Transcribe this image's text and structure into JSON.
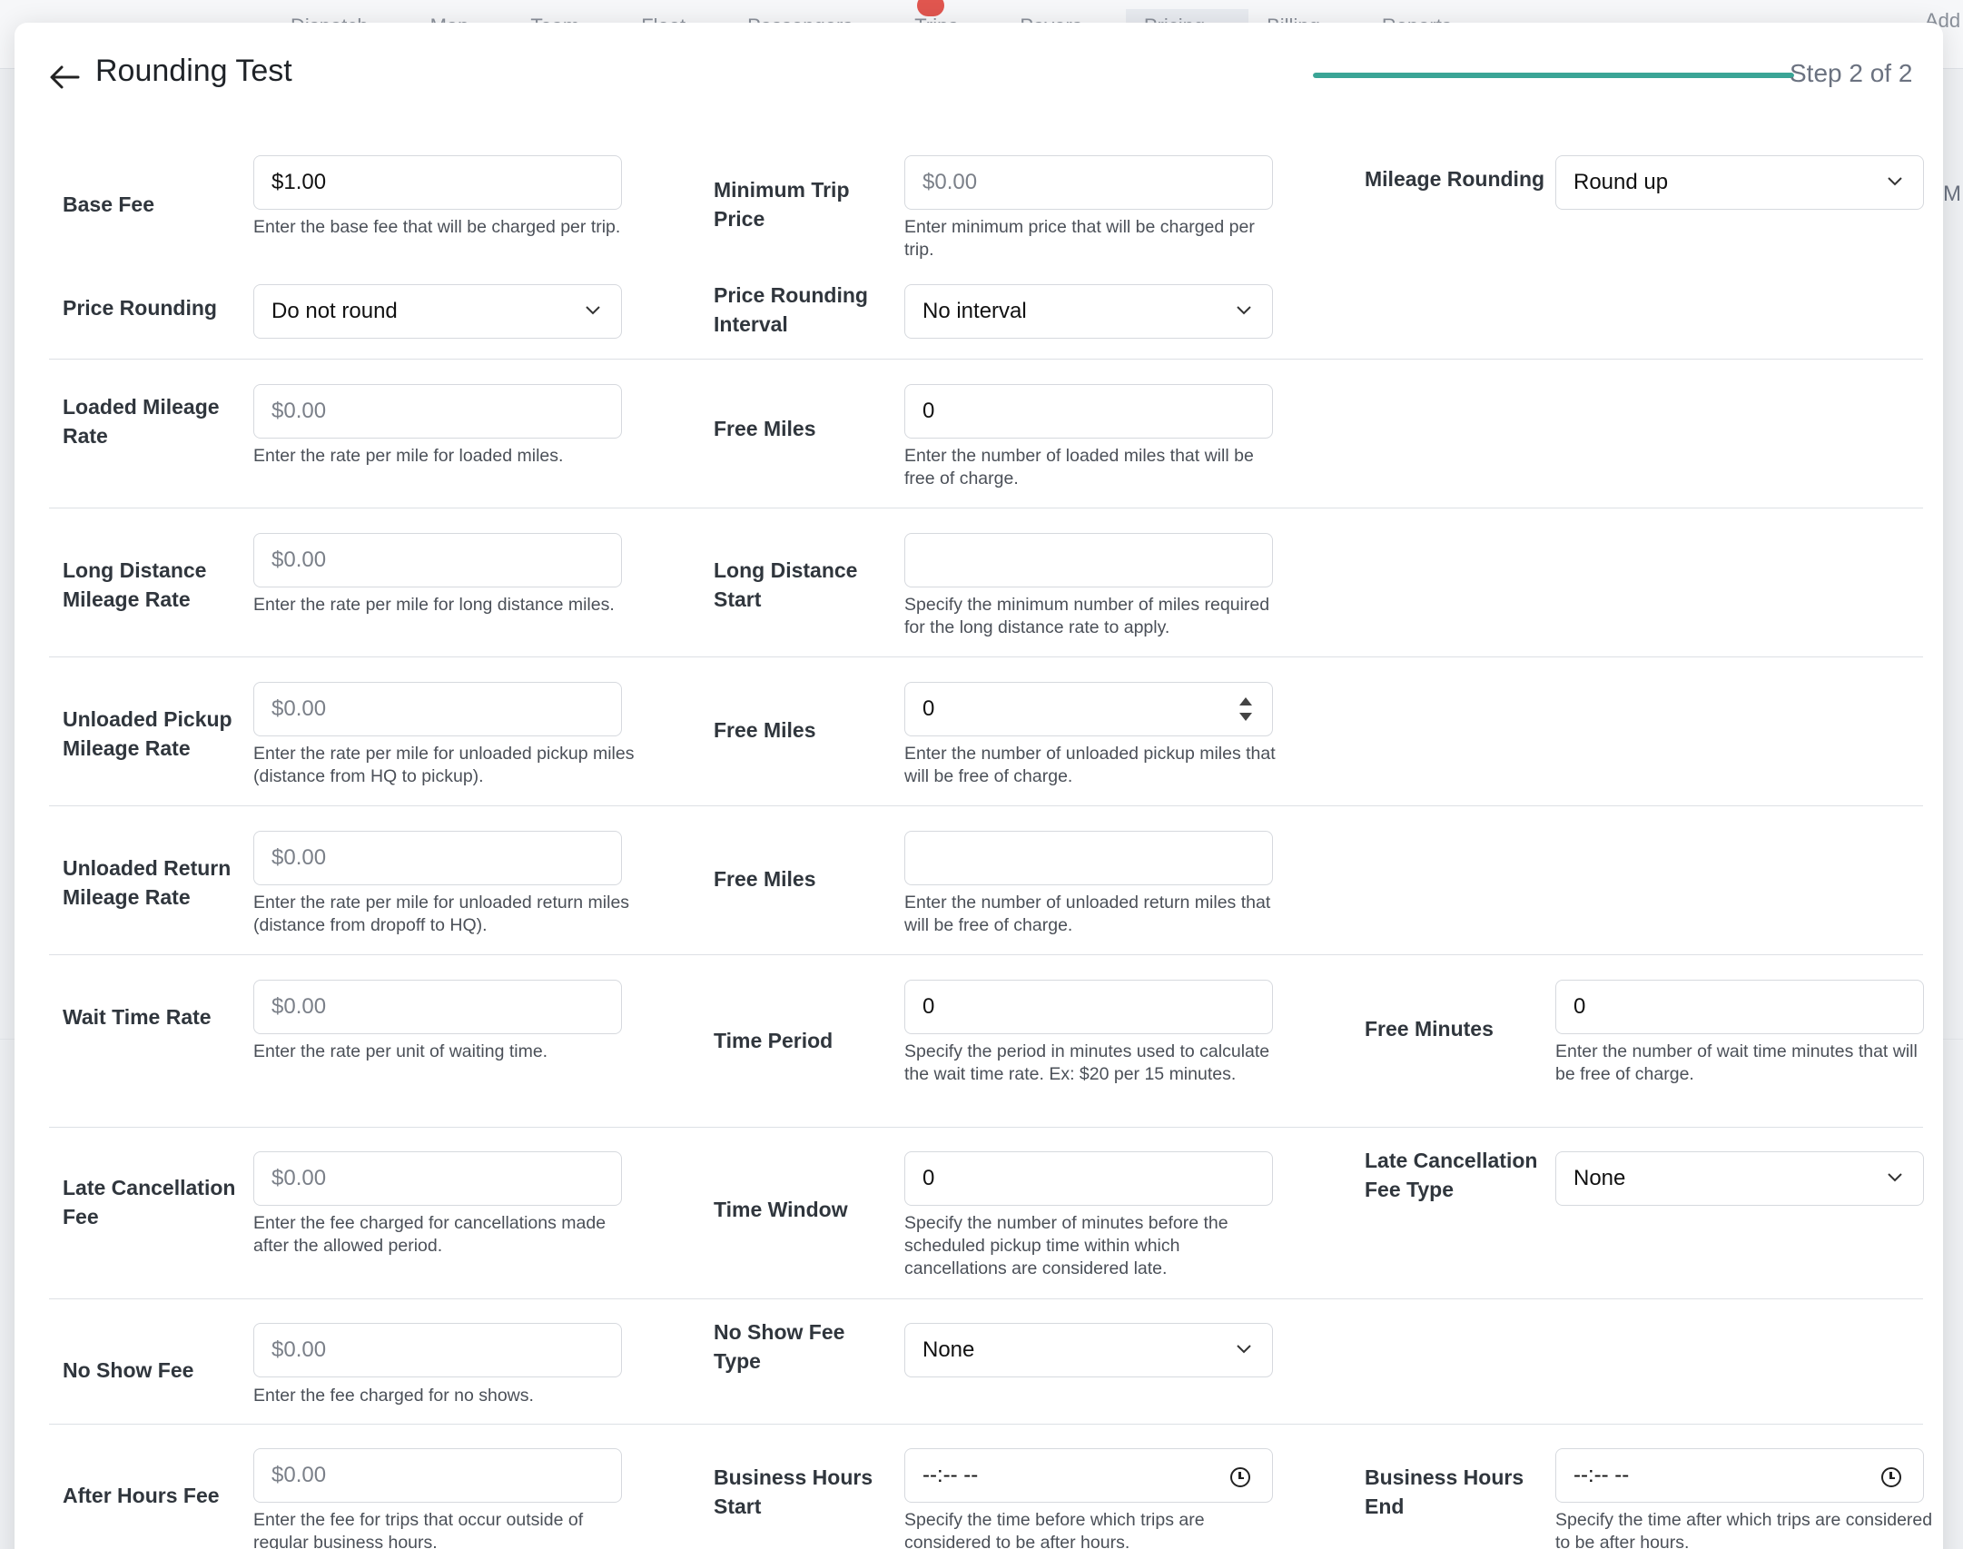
{
  "background": {
    "tabs": [
      "Dispatch",
      "Map",
      "Team",
      "Fleet",
      "Passengers",
      "Trips",
      "Payers",
      "Pricing",
      "Billing",
      "Reports"
    ],
    "right_text": "Add",
    "side_letter": "M"
  },
  "header": {
    "title": "Rounding Test",
    "step_label": "Step 2 of 2",
    "progress_fraction": 1.0
  },
  "colors": {
    "accent": "#3aa596"
  },
  "fields": {
    "base_fee": {
      "label": "Base Fee",
      "value": "$1.00",
      "help": "Enter the base fee that will be charged per trip."
    },
    "minimum_trip_price": {
      "label": "Minimum Trip Price",
      "placeholder": "$0.00",
      "help": "Enter minimum price that will be charged per trip."
    },
    "mileage_rounding": {
      "label": "Mileage Rounding",
      "value": "Round up"
    },
    "price_rounding": {
      "label": "Price Rounding",
      "value": "Do not round"
    },
    "price_rounding_interval": {
      "label": "Price Rounding Interval",
      "value": "No interval"
    },
    "loaded_mileage_rate": {
      "label": "Loaded Mileage Rate",
      "placeholder": "$0.00",
      "help": "Enter the rate per mile for loaded miles."
    },
    "loaded_free_miles": {
      "label": "Free Miles",
      "value": "0",
      "help": "Enter the number of loaded miles that will be free of charge."
    },
    "long_distance_rate": {
      "label": "Long Distance Mileage Rate",
      "placeholder": "$0.00",
      "help": "Enter the rate per mile for long distance miles."
    },
    "long_distance_start": {
      "label": "Long Distance Start",
      "value": "",
      "help": "Specify the minimum number of miles required for the long distance rate to apply."
    },
    "unloaded_pickup_rate": {
      "label": "Unloaded Pickup Mileage Rate",
      "placeholder": "$0.00",
      "help": "Enter the rate per mile for unloaded pickup miles (distance from HQ to pickup)."
    },
    "unloaded_pickup_free_miles": {
      "label": "Free Miles",
      "value": "0",
      "help": "Enter the number of unloaded pickup miles that will be free of charge."
    },
    "unloaded_return_rate": {
      "label": "Unloaded Return Mileage Rate",
      "placeholder": "$0.00",
      "help": "Enter the rate per mile for unloaded return miles (distance from dropoff to HQ)."
    },
    "unloaded_return_free_miles": {
      "label": "Free Miles",
      "value": "",
      "help": "Enter the number of unloaded return miles that will be free of charge."
    },
    "wait_time_rate": {
      "label": "Wait Time Rate",
      "placeholder": "$0.00",
      "help": "Enter the rate per unit of waiting time."
    },
    "time_period": {
      "label": "Time Period",
      "value": "0",
      "help": "Specify the period in minutes used to calculate the wait time rate. Ex: $20 per 15 minutes."
    },
    "free_minutes": {
      "label": "Free Minutes",
      "value": "0",
      "help": "Enter the number of wait time minutes that will be free of charge."
    },
    "late_cancellation_fee": {
      "label": "Late Cancellation Fee",
      "placeholder": "$0.00",
      "help": "Enter the fee charged for cancellations made after the allowed period."
    },
    "time_window": {
      "label": "Time Window",
      "value": "0",
      "help": "Specify the number of minutes before the scheduled pickup time within which cancellations are considered late."
    },
    "late_cancellation_fee_type": {
      "label": "Late Cancellation Fee Type",
      "value": "None"
    },
    "no_show_fee": {
      "label": "No Show Fee",
      "placeholder": "$0.00",
      "help": "Enter the fee charged for no shows."
    },
    "no_show_fee_type": {
      "label": "No Show Fee Type",
      "value": "None"
    },
    "after_hours_fee": {
      "label": "After Hours Fee",
      "placeholder": "$0.00",
      "help": "Enter the fee for trips that occur outside of regular business hours."
    },
    "business_hours_start": {
      "label": "Business Hours Start",
      "value": "--:-- --",
      "help": "Specify the time before which trips are considered to be after hours."
    },
    "business_hours_end": {
      "label": "Business Hours End",
      "value": "--:-- --",
      "help": "Specify the time after which trips are considered to be after hours."
    }
  }
}
